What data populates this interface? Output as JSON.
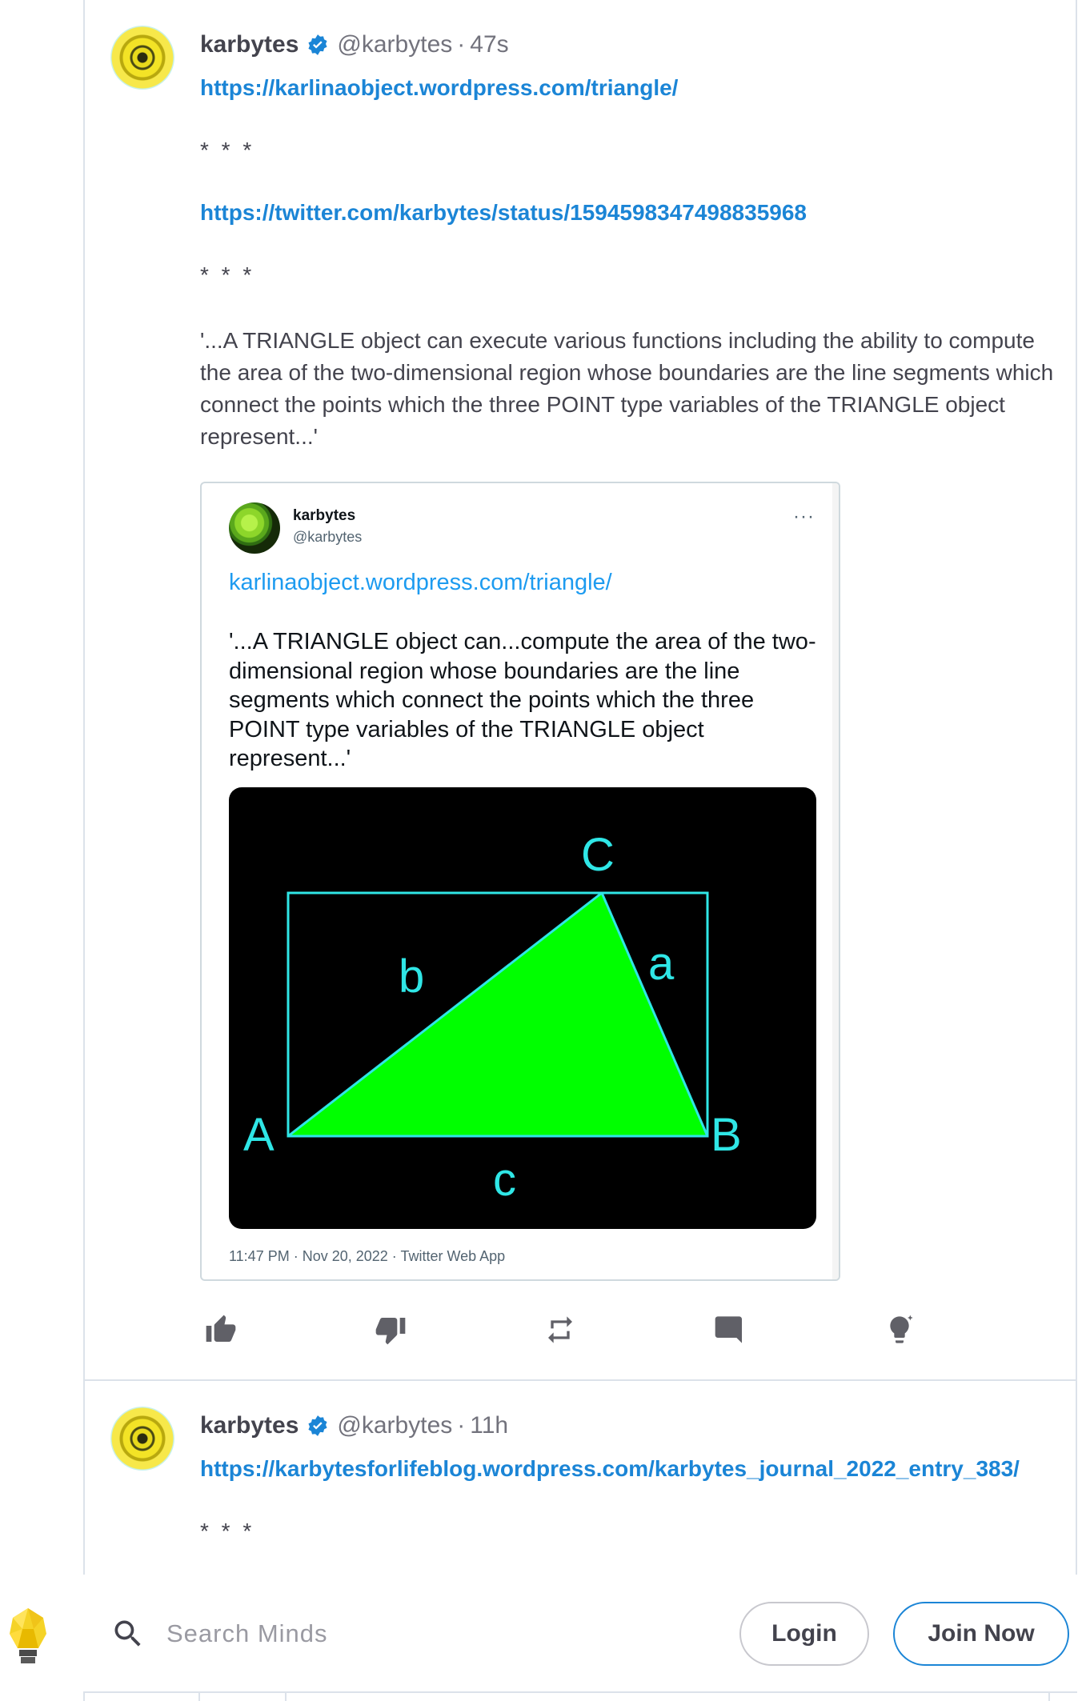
{
  "posts": [
    {
      "author_name": "karbytes",
      "handle": "@karbytes",
      "separator": "·",
      "timestamp": "47s",
      "link1": "https://karlinaobject.wordpress.com/triangle/",
      "stars1": "* * *",
      "link2": "https://twitter.com/karbytes/status/1594598347498835968",
      "stars2": "* * *",
      "quote": "'...A TRIANGLE object can execute various functions including the ability to compute the area of the two-dimensional region whose boundaries are the line segments which connect the points which the three POINT type variables of the TRIANGLE object represent...'",
      "embed": {
        "name": "karbytes",
        "handle": "@karbytes",
        "more": "···",
        "link": "karlinaobject.wordpress.com/triangle/",
        "text": "'...A TRIANGLE object can...compute the area of the two-dimensional region whose boundaries are the line segments which connect the points which the three POINT type variables of the TRIANGLE object represent...'",
        "image_labels": {
          "A": "A",
          "B": "B",
          "C": "C",
          "a": "a",
          "b": "b",
          "c": "c"
        },
        "colors": {
          "background": "#000000",
          "triangle": "#00ff00",
          "lines": "#2fe6e6"
        },
        "meta": "11:47 PM · Nov 20, 2022 · Twitter Web App"
      },
      "actions": [
        "thumbs-up-icon",
        "thumbs-down-icon",
        "remind-icon",
        "comment-icon",
        "boost-icon"
      ]
    },
    {
      "author_name": "karbytes",
      "handle": "@karbytes",
      "separator": "·",
      "timestamp": "11h",
      "link1": "https://karbytesforlifeblog.wordpress.com/karbytes_journal_2022_entry_383/",
      "stars1": "* * *"
    }
  ],
  "bottom_bar": {
    "search_placeholder": "Search Minds",
    "login_label": "Login",
    "join_label": "Join Now"
  },
  "colors": {
    "link": "#1b85d6",
    "verified": "#1b85d6",
    "border": "#dce2ea"
  }
}
